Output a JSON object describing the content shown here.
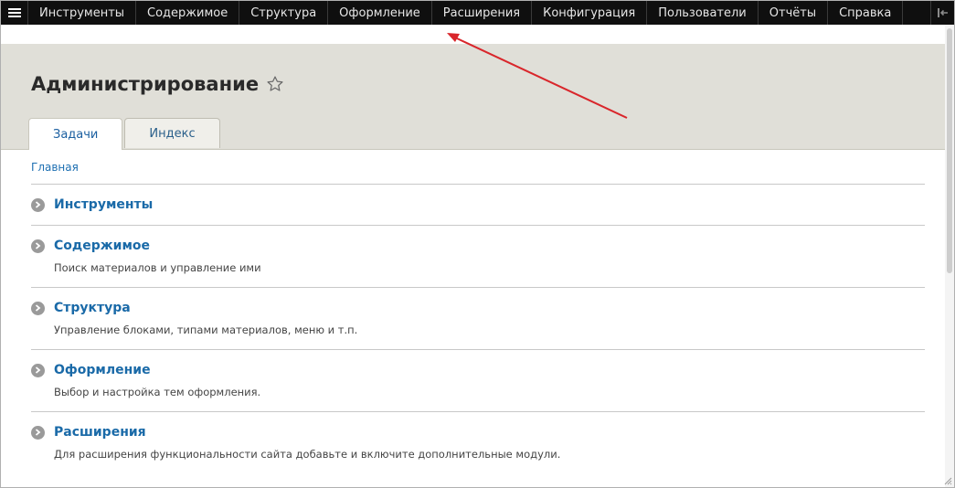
{
  "toolbar": {
    "items": [
      "Инструменты",
      "Содержимое",
      "Структура",
      "Оформление",
      "Расширения",
      "Конфигурация",
      "Пользователи",
      "Отчёты",
      "Справка"
    ]
  },
  "header": {
    "title": "Администрирование",
    "tabs": [
      {
        "label": "Задачи",
        "active": true
      },
      {
        "label": "Индекс",
        "active": false
      }
    ]
  },
  "breadcrumb": "Главная",
  "items": [
    {
      "title": "Инструменты",
      "desc": ""
    },
    {
      "title": "Содержимое",
      "desc": "Поиск материалов и управление ими"
    },
    {
      "title": "Структура",
      "desc": "Управление блоками, типами материалов, меню и т.п."
    },
    {
      "title": "Оформление",
      "desc": "Выбор и настройка тем оформления."
    },
    {
      "title": "Расширения",
      "desc": "Для расширения функциональности сайта добавьте и включите дополнительные модули."
    }
  ],
  "colors": {
    "annotation_arrow": "#d9262b",
    "link": "#1a6aa8",
    "toolbar": "#0f0f0f"
  }
}
